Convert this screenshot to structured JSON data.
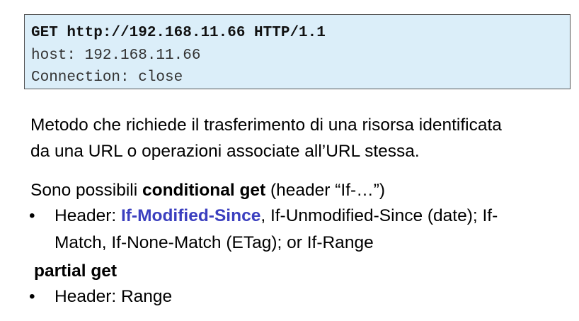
{
  "code_block": {
    "line1": "GET http://192.168.11.66 HTTP/1.1",
    "line2": "host: 192.168.11.66",
    "line3": "Connection: close"
  },
  "description": {
    "line1": "Metodo che richiede il trasferimento di una risorsa identificata",
    "line2": "da una URL o operazioni associate all’URL stessa."
  },
  "conditional": {
    "prefix": "Sono possibili ",
    "bold": "conditional get",
    "suffix": " (header “If-…”)"
  },
  "bullet1": {
    "marker": "•",
    "prefix": "Header: ",
    "highlight": "If-Modified-Since",
    "rest": ", If-Unmodified-Since (date); If-",
    "line2": "Match, If-None-Match (ETag); or If-Range"
  },
  "partial": {
    "label": "partial get"
  },
  "bullet2": {
    "marker": "•",
    "text": "Header: Range"
  },
  "colors": {
    "code_background": "#dbeef9",
    "highlight": "#3b3fbf"
  }
}
